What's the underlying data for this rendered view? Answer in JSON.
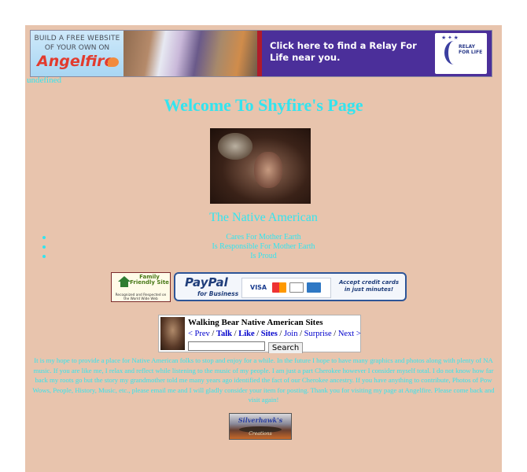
{
  "banner": {
    "angelfire_line1": "BUILD A FREE WEBSITE",
    "angelfire_line2": "OF YOUR OWN ON",
    "angelfire_logo": "Angelfire",
    "relay_text": "Click here to find a Relay For Life near you.",
    "relay_logo_text": "RELAY FOR LIFE"
  },
  "undefined_text": "undefined",
  "title": "Welcome To Shyfire's Page",
  "subtitle": "The Native American",
  "bullets": [
    "Cares For Mother Earth",
    "Is Responsible For Mother Earth",
    "Is Proud"
  ],
  "family_badge": {
    "text": "Family Friendly Site",
    "caption": "Recognized and Respected on the World Wide Web"
  },
  "paypal": {
    "logo": "PayPal",
    "sub": "for Business",
    "visa": "VISA",
    "accept": "Accept credit cards in just minutes!"
  },
  "webring": {
    "title": "Walking Bear Native American Sites",
    "prev": "< Prev",
    "talk": "Talk",
    "like": "Like",
    "sites": "Sites",
    "join": "Join",
    "surprise": "Surprise",
    "next": "Next >",
    "search_value": "",
    "search_button": "Search"
  },
  "paragraph": "It is my hope to provide a place for Native American folks to stop and enjoy for a while. In the future I hope to have many graphics and photos along with plenty of NA music. If you are like me, I relax and reflect while listening to the music of my people. I am just a part Cherokee however I consider myself total. I do not know how far back my roots go but the story my grandmother told me many years ago identified the fact of our Cherokee ancestry. If you have anything to contribute, Photos of Pow Wows, People, History, Music, etc., please email me and I will gladly consider your item for posting. Thank you for visiting my page at Angelfire. Please come back and visit again!",
  "silverhawk": {
    "text": "Silverhawk's",
    "sub": "Creations"
  },
  "colors": {
    "page_bg": "#e8c4ad",
    "text": "#33e4ef",
    "banner_purple": "#4b2f9a"
  }
}
